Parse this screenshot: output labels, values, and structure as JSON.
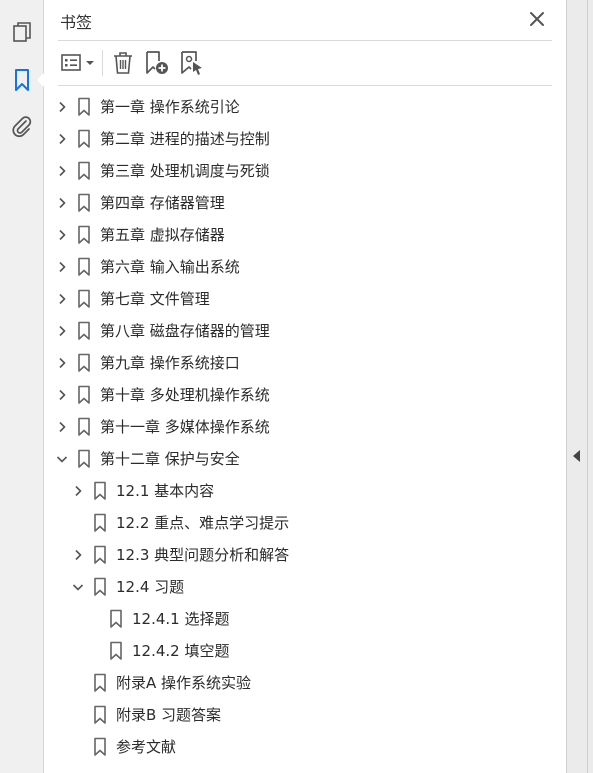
{
  "panel": {
    "title": "书签"
  },
  "bookmarks": [
    {
      "label": "第一章 操作系统引论",
      "level": 0,
      "state": "collapsed"
    },
    {
      "label": "第二章 进程的描述与控制",
      "level": 0,
      "state": "collapsed"
    },
    {
      "label": "第三章 处理机调度与死锁",
      "level": 0,
      "state": "collapsed"
    },
    {
      "label": "第四章 存储器管理",
      "level": 0,
      "state": "collapsed"
    },
    {
      "label": "第五章 虚拟存储器",
      "level": 0,
      "state": "collapsed"
    },
    {
      "label": "第六章 输入输出系统",
      "level": 0,
      "state": "collapsed"
    },
    {
      "label": "第七章 文件管理",
      "level": 0,
      "state": "collapsed"
    },
    {
      "label": "第八章 磁盘存储器的管理",
      "level": 0,
      "state": "collapsed"
    },
    {
      "label": "第九章 操作系统接口",
      "level": 0,
      "state": "collapsed"
    },
    {
      "label": "第十章 多处理机操作系统",
      "level": 0,
      "state": "collapsed"
    },
    {
      "label": "第十一章 多媒体操作系统",
      "level": 0,
      "state": "collapsed"
    },
    {
      "label": "第十二章 保护与安全",
      "level": 0,
      "state": "expanded"
    },
    {
      "label": "12.1 基本内容",
      "level": 1,
      "state": "collapsed"
    },
    {
      "label": "12.2 重点、难点学习提示",
      "level": 1,
      "state": "leaf"
    },
    {
      "label": "12.3 典型问题分析和解答",
      "level": 1,
      "state": "collapsed"
    },
    {
      "label": "12.4 习题",
      "level": 1,
      "state": "expanded"
    },
    {
      "label": "12.4.1 选择题",
      "level": 2,
      "state": "leaf"
    },
    {
      "label": "12.4.2 填空题",
      "level": 2,
      "state": "leaf"
    },
    {
      "label": "附录A  操作系统实验",
      "level": 1,
      "state": "leaf"
    },
    {
      "label": "附录B  习题答案",
      "level": 1,
      "state": "leaf"
    },
    {
      "label": "参考文献",
      "level": 1,
      "state": "leaf"
    }
  ],
  "icons": {
    "rail": [
      "pages-icon",
      "bookmark-icon",
      "attachment-icon"
    ],
    "toolbar": [
      "options-menu-icon",
      "delete-icon",
      "new-bookmark-icon",
      "bookmark-from-selection-icon"
    ]
  },
  "colors": {
    "accent": "#1473e6",
    "icon": "#555555"
  }
}
